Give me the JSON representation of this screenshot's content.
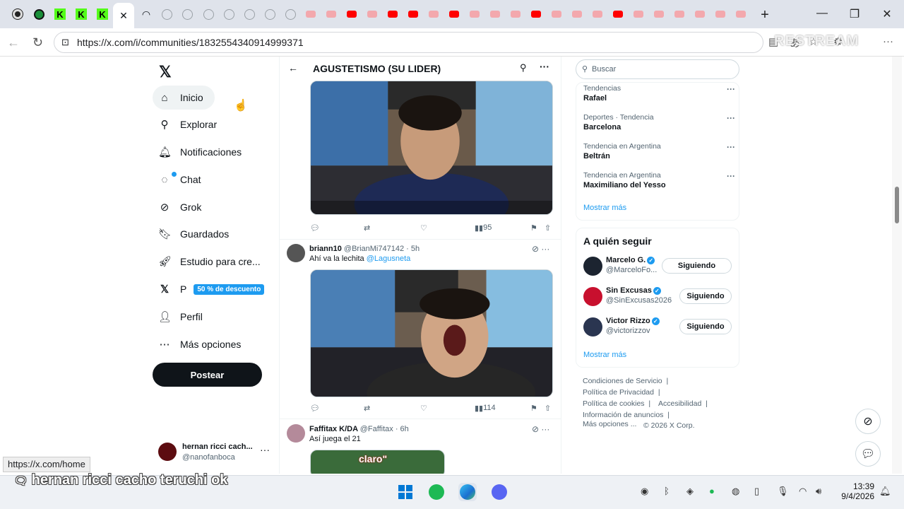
{
  "browser": {
    "url": "https://x.com/i/communities/1832554340914999371",
    "overlay_watermark": "RESTREAM",
    "status_tooltip": "https://x.com/home"
  },
  "nav": {
    "items": [
      {
        "label": "Inicio",
        "icon": "home-icon"
      },
      {
        "label": "Explorar",
        "icon": "search-icon"
      },
      {
        "label": "Notificaciones",
        "icon": "bell-icon"
      },
      {
        "label": "Chat",
        "icon": "chat-icon"
      },
      {
        "label": "Grok",
        "icon": "grok-icon"
      },
      {
        "label": "Guardados",
        "icon": "bookmark-icon"
      },
      {
        "label": "Estudio para cre...",
        "icon": "rocket-icon"
      },
      {
        "label": "P",
        "icon": "x-premium-icon",
        "badge": "50 % de descuento"
      },
      {
        "label": "Perfil",
        "icon": "person-icon"
      },
      {
        "label": "Más opciones",
        "icon": "more-circle-icon"
      }
    ],
    "post_button": "Postear",
    "account": {
      "name": "hernan ricci cach...",
      "handle": "@nanofanboca"
    }
  },
  "community": {
    "title": "AGUSTETISMO (SU LIDER)"
  },
  "feed": {
    "post1": {
      "views": "95"
    },
    "post2": {
      "name": "briann10",
      "handle": "@BrianMi747142",
      "time": "· 5h",
      "text": "Ahí va la lechita",
      "mention": "@Lagusneta",
      "views": "114"
    },
    "post3": {
      "name": "Faffitax K/DA",
      "handle": "@Faffitax",
      "time": "· 6h",
      "text": "Así juega el 21",
      "media_text": "claro\""
    }
  },
  "sidebar": {
    "search_placeholder": "Buscar",
    "trends": [
      {
        "category": "Tendencias",
        "name": "Rafael"
      },
      {
        "category": "Deportes · Tendencia",
        "name": "Barcelona"
      },
      {
        "category": "Tendencia en Argentina",
        "name": "Beltrán"
      },
      {
        "category": "Tendencia en Argentina",
        "name": "Maximiliano del Yesso"
      }
    ],
    "show_more": "Mostrar más",
    "who_to_follow_title": "A quién seguir",
    "follow": [
      {
        "name": "Marcelo G.",
        "handle": "@MarceloFo...",
        "button": "Siguiendo"
      },
      {
        "name": "Sin Excusas",
        "handle": "@SinExcusas2026",
        "button": "Siguiendo"
      },
      {
        "name": "Victor Rizzo",
        "handle": "@victorizzov",
        "button": "Siguiendo"
      }
    ],
    "follow_show_more": "Mostrar más",
    "footer": [
      "Condiciones de Servicio",
      "Política de Privacidad",
      "Política de cookies",
      "Accesibilidad",
      "Información de anuncios",
      "Más opciones ...",
      "© 2026 X Corp."
    ]
  },
  "stream_caption": "hernan ricci cacho teruchi ok",
  "taskbar": {
    "time": "13:39",
    "date": "9/4/2026"
  },
  "colors": {
    "accent": "#1d9bf0",
    "text": "#0f1419",
    "muted": "#536471"
  }
}
